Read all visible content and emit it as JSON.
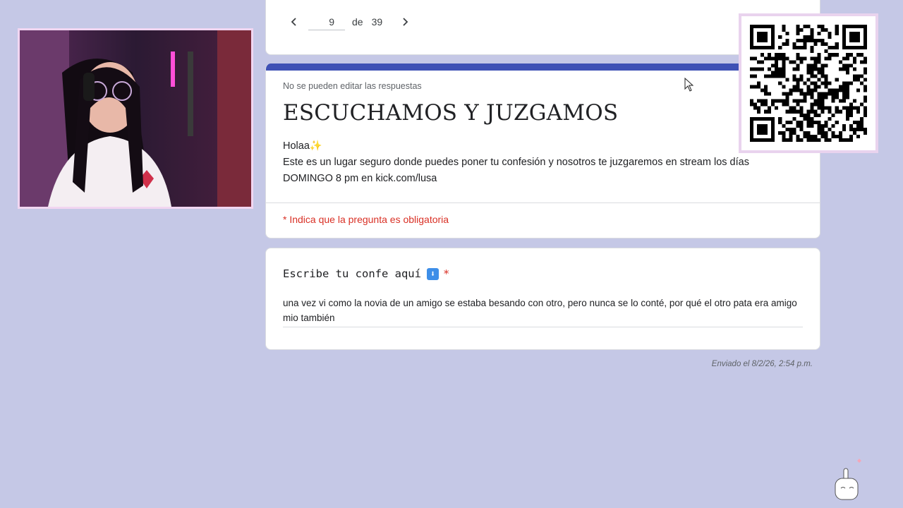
{
  "pager": {
    "current_page": "9",
    "of_label": "de",
    "total_pages": "39"
  },
  "form": {
    "no_edit_notice": "No se pueden editar las respuestas",
    "title": "ESCUCHAMOS Y JUZGAMOS",
    "greeting": "Holaa",
    "greeting_emoji": "✨",
    "description": "Este es un lugar seguro donde puedes poner tu confesión y nosotros te juzgaremos en stream los días DOMINGO 8 pm en kick.com/lusa",
    "required_note": "* Indica que la pregunta es obligatoria"
  },
  "question": {
    "label": "Escribe tu confe aquí",
    "emoji": "⬇",
    "required_marker": "*",
    "answer": "una vez vi como la novia de un amigo se estaba besando con otro, pero nunca se lo conté, por qué el otro pata era amigo mio también"
  },
  "submitted_text": "Enviado el 8/2/26, 2:54 p.m.",
  "colors": {
    "background": "#c5c8e6",
    "form_accent": "#3f51b5",
    "required_red": "#d93025"
  },
  "icons": {
    "prev": "chevron-left-icon",
    "next": "chevron-right-icon",
    "cursor": "mouse-pointer-icon"
  }
}
